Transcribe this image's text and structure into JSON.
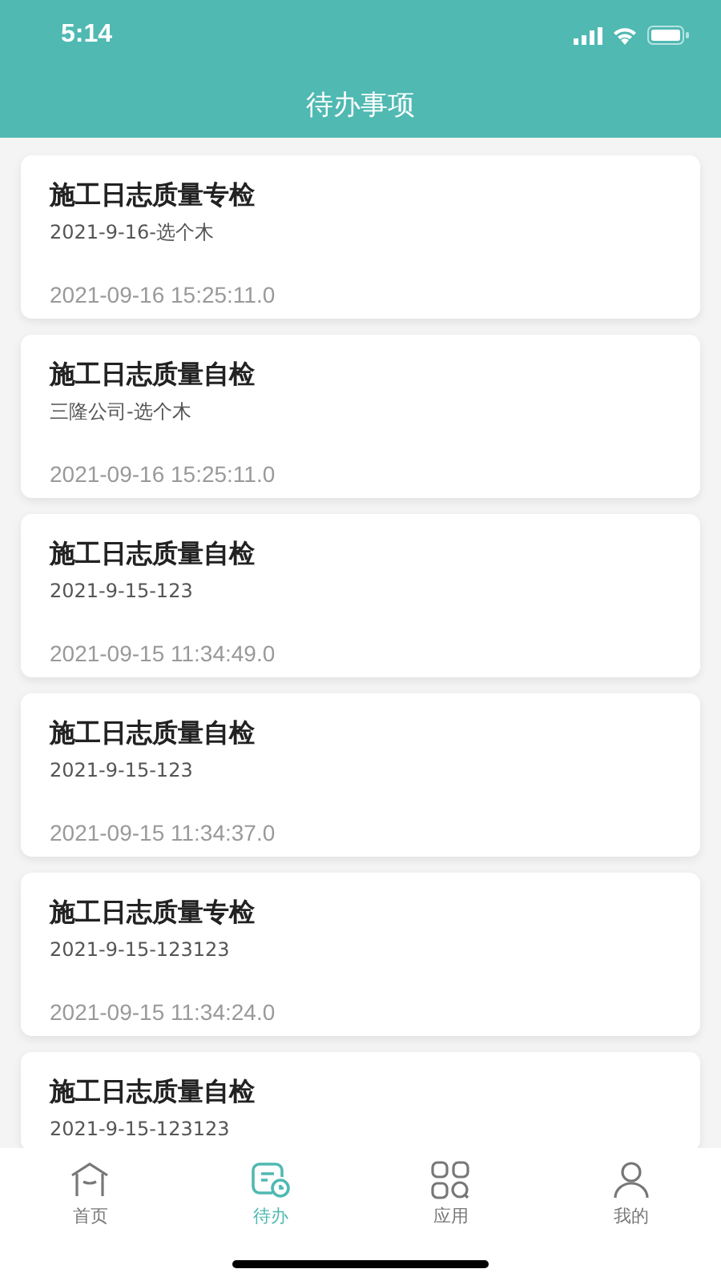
{
  "status_bar": {
    "time": "5:14"
  },
  "header": {
    "title": "待办事项"
  },
  "tasks": [
    {
      "title": "施工日志质量专检",
      "subtitle": "2021-9-16-选个木",
      "time": "2021-09-16 15:25:11.0"
    },
    {
      "title": "施工日志质量自检",
      "subtitle": "三隆公司-选个木",
      "time": "2021-09-16 15:25:11.0"
    },
    {
      "title": "施工日志质量自检",
      "subtitle": "2021-9-15-123",
      "time": "2021-09-15 11:34:49.0"
    },
    {
      "title": "施工日志质量自检",
      "subtitle": "2021-9-15-123",
      "time": "2021-09-15 11:34:37.0"
    },
    {
      "title": "施工日志质量专检",
      "subtitle": "2021-9-15-123123",
      "time": "2021-09-15 11:34:24.0"
    },
    {
      "title": "施工日志质量自检",
      "subtitle": "2021-9-15-123123"
    }
  ],
  "tab_bar": [
    {
      "label": "首页",
      "kind": "home",
      "selected": false
    },
    {
      "label": "待办",
      "kind": "todo",
      "selected": true
    },
    {
      "label": "应用",
      "kind": "apps",
      "selected": false
    },
    {
      "label": "我的",
      "kind": "profile",
      "selected": false
    }
  ]
}
